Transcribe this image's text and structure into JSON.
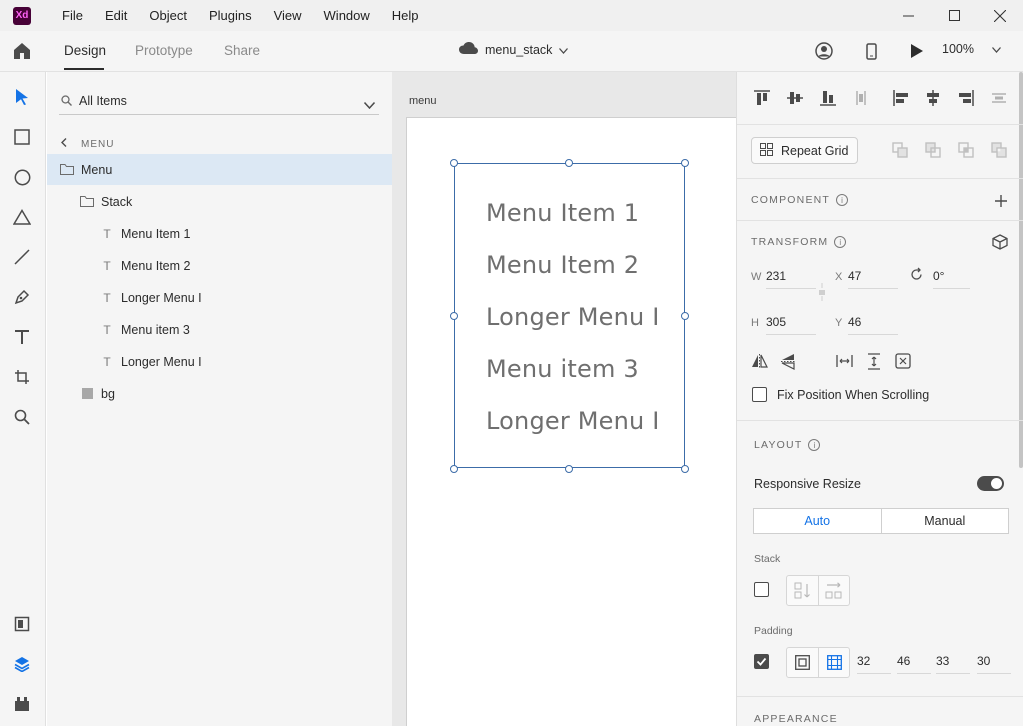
{
  "app": {
    "logo_text": "Xd"
  },
  "menubar": [
    "File",
    "Edit",
    "Object",
    "Plugins",
    "View",
    "Window",
    "Help"
  ],
  "window_controls": [
    "minimize-icon",
    "maximize-icon",
    "close-icon"
  ],
  "toolbar": {
    "tabs": [
      {
        "label": "Design",
        "active": true
      },
      {
        "label": "Prototype",
        "active": false
      },
      {
        "label": "Share",
        "active": false
      }
    ],
    "document_title": "menu_stack",
    "zoom": "100%"
  },
  "rail_tools": [
    "select-icon",
    "rectangle-icon",
    "ellipse-icon",
    "polygon-icon",
    "line-icon",
    "pen-icon",
    "text-icon",
    "artboard-icon",
    "zoom-icon"
  ],
  "rail_bottom": [
    "assets-icon",
    "layers-icon",
    "plugins-icon"
  ],
  "layers": {
    "search_label": "All Items",
    "breadcrumb": "MENU",
    "items": [
      {
        "label": "Menu",
        "icon": "folder-icon",
        "selected": true
      },
      {
        "label": "Stack",
        "icon": "folder-icon",
        "selected": false
      },
      {
        "label": "Menu Item 1",
        "icon": "text-layer-icon",
        "selected": false
      },
      {
        "label": "Menu Item 2",
        "icon": "text-layer-icon",
        "selected": false
      },
      {
        "label": "Longer Menu I",
        "icon": "text-layer-icon",
        "selected": false
      },
      {
        "label": "Menu item 3",
        "icon": "text-layer-icon",
        "selected": false
      },
      {
        "label": "Longer Menu I",
        "icon": "text-layer-icon",
        "selected": false
      },
      {
        "label": "bg",
        "icon": "rectangle-layer-icon",
        "selected": false
      }
    ]
  },
  "canvas": {
    "artboard_label": "menu",
    "menu_items": [
      "Menu Item 1",
      "Menu Item 2",
      "Longer Menu I",
      "Menu item 3",
      "Longer Menu I"
    ]
  },
  "inspector": {
    "repeat_grid_label": "Repeat Grid",
    "component_title": "COMPONENT",
    "transform_title": "TRANSFORM",
    "transform": {
      "w_label": "W",
      "w": "231",
      "x_label": "X",
      "x": "47",
      "h_label": "H",
      "h": "305",
      "y_label": "Y",
      "y": "46",
      "rotation": "0°"
    },
    "fix_position_label": "Fix Position When Scrolling",
    "fix_position_checked": false,
    "layout_title": "LAYOUT",
    "responsive_resize_label": "Responsive Resize",
    "responsive_resize_on": true,
    "resize_modes": [
      "Auto",
      "Manual"
    ],
    "resize_active": "Auto",
    "stack_label": "Stack",
    "stack_checked": false,
    "padding_label": "Padding",
    "padding_checked": true,
    "padding_values": [
      "32",
      "46",
      "33",
      "30"
    ],
    "appearance_title": "APPEARANCE"
  },
  "colors": {
    "selection": "#3c6ca8",
    "layer_selected_bg": "#dce8f4",
    "accent": "#1473e6",
    "xd_brand": "#470137"
  }
}
